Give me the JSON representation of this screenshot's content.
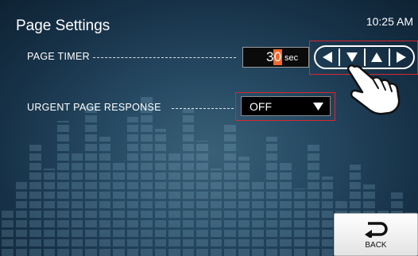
{
  "header": {
    "title": "Page Settings",
    "time": "10:25 AM"
  },
  "page_timer": {
    "label": "PAGE TIMER",
    "digit_tens": "3",
    "digit_ones": "0",
    "unit": "sec",
    "buttons": {
      "left": "left-arrow-icon",
      "down": "down-arrow-icon",
      "up": "up-arrow-icon",
      "right": "right-arrow-icon"
    }
  },
  "urgent_page_response": {
    "label": "URGENT PAGE RESPONSE",
    "value": "OFF"
  },
  "footer": {
    "back_label": "BACK"
  },
  "colors": {
    "highlight": "#d9262f",
    "selected_digit": "#f0692b",
    "text": "#ffffff"
  }
}
